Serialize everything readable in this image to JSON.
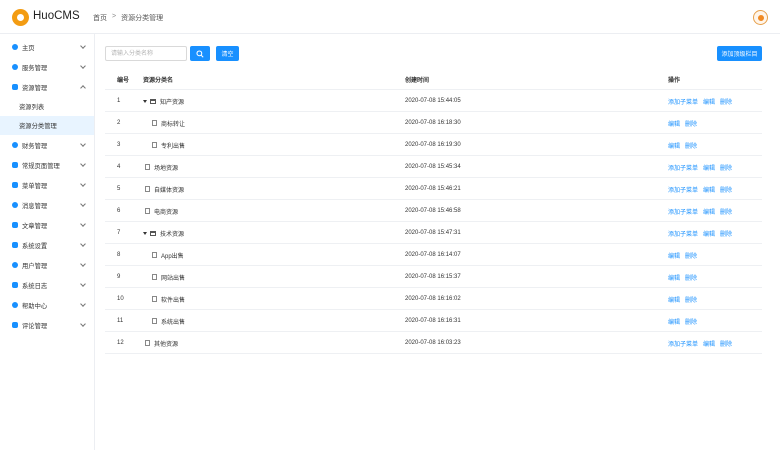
{
  "app": {
    "title": "HuoCMS"
  },
  "breadcrumb": {
    "home": "首页",
    "sep": ">",
    "current": "资源分类管理"
  },
  "sidebar": {
    "items": [
      {
        "label": "主页"
      },
      {
        "label": "服务管理"
      },
      {
        "label": "资源管理",
        "children": [
          "资源列表",
          "资源分类管理"
        ]
      },
      {
        "label": "财务管理"
      },
      {
        "label": "常规页面管理"
      },
      {
        "label": "菜单管理"
      },
      {
        "label": "消息管理"
      },
      {
        "label": "文章管理"
      },
      {
        "label": "系统设置"
      },
      {
        "label": "用户管理"
      },
      {
        "label": "系统日志"
      },
      {
        "label": "帮助中心"
      },
      {
        "label": "评论管理"
      }
    ]
  },
  "toolbar": {
    "search_placeholder": "请输入分类名称",
    "clear_label": "清空",
    "add_top_label": "添加顶级栏目"
  },
  "table": {
    "headers": {
      "no": "编号",
      "name": "资源分类名",
      "time": "创建时间",
      "op": "操作"
    },
    "ops": {
      "add_child": "添加子菜单",
      "edit": "编辑",
      "delete": "删除"
    },
    "rows": [
      {
        "no": "1",
        "name": "知产资源",
        "time": "2020-07-08 15:44:05"
      },
      {
        "no": "2",
        "name": "商标转让",
        "time": "2020-07-08 16:18:30"
      },
      {
        "no": "3",
        "name": "专利出售",
        "time": "2020-07-08 16:19:30"
      },
      {
        "no": "4",
        "name": "场地资源",
        "time": "2020-07-08 15:45:34"
      },
      {
        "no": "5",
        "name": "自媒体资源",
        "time": "2020-07-08 15:46:21"
      },
      {
        "no": "6",
        "name": "电商资源",
        "time": "2020-07-08 15:46:58"
      },
      {
        "no": "7",
        "name": "技术资源",
        "time": "2020-07-08 15:47:31"
      },
      {
        "no": "8",
        "name": "App出售",
        "time": "2020-07-08 16:14:07"
      },
      {
        "no": "9",
        "name": "网站出售",
        "time": "2020-07-08 16:15:37"
      },
      {
        "no": "10",
        "name": "软件出售",
        "time": "2020-07-08 16:16:02"
      },
      {
        "no": "11",
        "name": "系统出售",
        "time": "2020-07-08 16:16:31"
      },
      {
        "no": "12",
        "name": "其他资源",
        "time": "2020-07-08 16:03:23"
      }
    ]
  },
  "colors": {
    "accent": "#1890ff",
    "brand": "#f39c12",
    "active_bg": "#e8f4ff"
  }
}
